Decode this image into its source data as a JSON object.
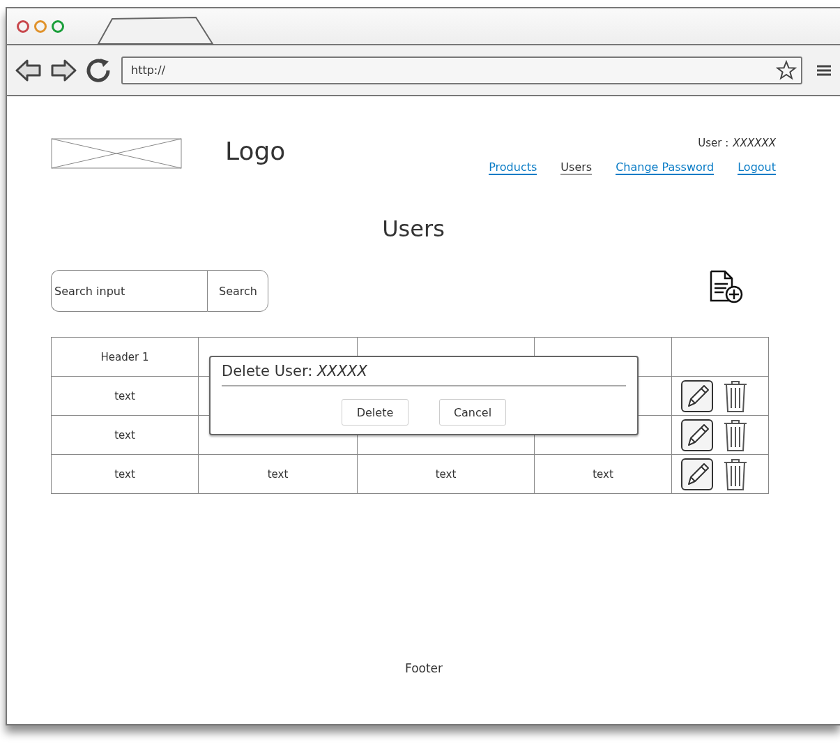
{
  "browser": {
    "url": "http://"
  },
  "header": {
    "logo": "Logo",
    "user_label": "User :",
    "user_name": "XXXXXX",
    "nav": [
      {
        "label": "Products",
        "selected": false
      },
      {
        "label": "Users",
        "selected": true
      },
      {
        "label": "Change Password",
        "selected": false
      },
      {
        "label": "Logout",
        "selected": false
      }
    ]
  },
  "page_title": "Users",
  "search": {
    "placeholder": "Search input",
    "button": "Search"
  },
  "table": {
    "columns": [
      "Header 1"
    ],
    "rows": [
      {
        "cells": [
          "text"
        ]
      },
      {
        "cells": [
          "text"
        ]
      },
      {
        "cells": [
          "text",
          "text",
          "text",
          "text"
        ]
      }
    ]
  },
  "dialog": {
    "title": "Delete User:",
    "name": "XXXXX",
    "buttons": [
      "Delete",
      "Cancel"
    ]
  },
  "footer": "Footer"
}
